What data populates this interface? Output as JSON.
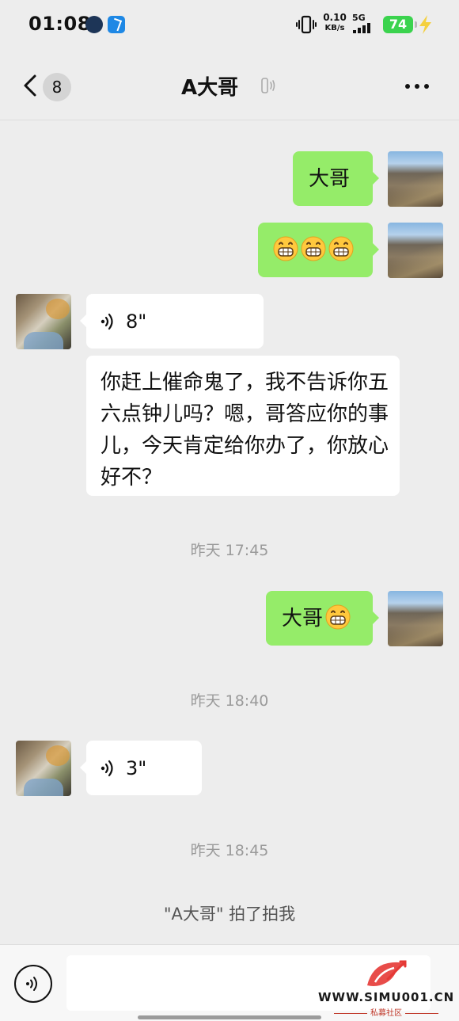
{
  "status_bar": {
    "time": "01:08",
    "speed_value": "0.10",
    "speed_unit": "KB/s",
    "network": "5G",
    "battery": "74"
  },
  "header": {
    "unread_count": "8",
    "title": "A大哥"
  },
  "messages": [
    {
      "side": "right",
      "text": "大哥"
    },
    {
      "side": "right",
      "emoji_count": 3,
      "emoji": "grinning-face"
    },
    {
      "side": "left",
      "voice_duration": "8\""
    },
    {
      "side": "left",
      "text": "你赶上催命鬼了，我不告诉你五六点钟儿吗？嗯，哥答应你的事儿，今天肯定给你办了，你放心好不？"
    },
    {
      "timestamp": "昨天 17:45"
    },
    {
      "side": "right",
      "text": "大哥",
      "emoji": "grinning-face"
    },
    {
      "timestamp": "昨天 18:40"
    },
    {
      "side": "left",
      "voice_duration": "3\""
    },
    {
      "timestamp": "昨天 18:45"
    },
    {
      "system": "\"A大哥\" 拍了拍我"
    }
  ],
  "watermark": {
    "url": "WWW.SIMU001.CN",
    "subtitle": "私募社区"
  },
  "colors": {
    "background": "#ededed",
    "my_bubble": "#95ec69",
    "their_bubble": "#ffffff",
    "battery": "#3bd34e",
    "watermark_red": "#e53935"
  }
}
